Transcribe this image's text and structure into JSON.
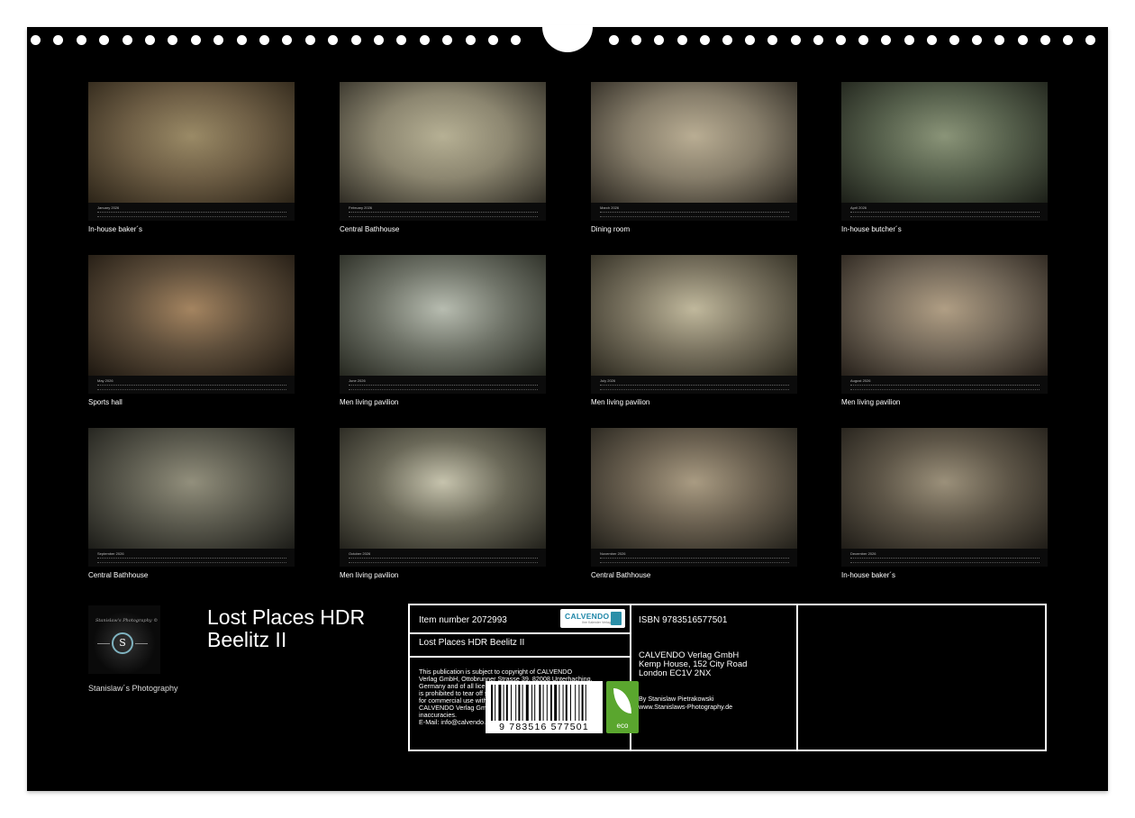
{
  "months": [
    {
      "month": "January 2026",
      "caption": "In-house baker´s",
      "colors": [
        "#6e5e45",
        "#2c2418",
        "#9a8a66"
      ]
    },
    {
      "month": "February 2026",
      "caption": "Central Bathhouse",
      "colors": [
        "#8c8670",
        "#2f2c24",
        "#b6b094"
      ]
    },
    {
      "month": "March 2026",
      "caption": "Dining room",
      "colors": [
        "#867d6a",
        "#2a261f",
        "#b9ad93"
      ]
    },
    {
      "month": "April 2026",
      "caption": "In-house butcher´s",
      "colors": [
        "#56604c",
        "#1c1f18",
        "#8a9478"
      ]
    },
    {
      "month": "May 2026",
      "caption": "Sports hall",
      "colors": [
        "#5e4e3b",
        "#1d1710",
        "#a48460"
      ]
    },
    {
      "month": "June 2026",
      "caption": "Men living pavilion",
      "colors": [
        "#6f7368",
        "#25271f",
        "#b7bcb0"
      ]
    },
    {
      "month": "July 2026",
      "caption": "Men living pavilion",
      "colors": [
        "#7a7360",
        "#2b281e",
        "#c0b89c"
      ]
    },
    {
      "month": "August 2026",
      "caption": "Men living pavilion",
      "colors": [
        "#74695a",
        "#26201a",
        "#b09e84"
      ]
    },
    {
      "month": "September 2026",
      "caption": "Central Bathhouse",
      "colors": [
        "#5b5a4e",
        "#1c1c18",
        "#928f7c"
      ]
    },
    {
      "month": "October 2026",
      "caption": "Men living pavilion",
      "colors": [
        "#6a6858",
        "#22211b",
        "#c6c3ad"
      ]
    },
    {
      "month": "November 2026",
      "caption": "Central Bathhouse",
      "colors": [
        "#6a6050",
        "#22201a",
        "#a99b82"
      ]
    },
    {
      "month": "December 2026",
      "caption": "In-house baker´s",
      "colors": [
        "#5d5547",
        "#1f1c17",
        "#9b907a"
      ]
    }
  ],
  "brand": {
    "logo_text": "Stanislaw's Photography ©",
    "logo_letter": "S",
    "credit": "Stanislaw´s Photography"
  },
  "title": {
    "line1": "Lost Places HDR",
    "line2": "Beelitz II"
  },
  "info": {
    "item_number": "Item number 2072993",
    "calvendo_logo": "CALVENDO",
    "calvendo_sub": "Ihre Kalender Verlag",
    "product_title": "Lost Places HDR Beelitz II",
    "legal": [
      "This publication is subject to copyright of CALVENDO",
      "Verlag GmbH, Ottobrunner Strasse 39, 82008 Unterhaching,",
      "Germany and of all licensed material of its licensers. It",
      "is prohibited to tear off single sheets of this calendar",
      "for commercial use without explicit permission.",
      "CALVENDO Verlag GmbH cannot be held responsible for any",
      "inaccuracies.",
      "E-Mail: info@calvendo.com • www.calvendo.com"
    ],
    "isbn": "ISBN 9783516577501",
    "publisher": [
      "CALVENDO Verlag GmbH",
      "Kemp House, 152 City Road",
      "London EC1V 2NX"
    ],
    "author": [
      "By Stanislaw Pietrakowski",
      "www.Stanislaws-Photography.de"
    ],
    "barcode_digits": "9 783516 577501",
    "eco_label": "eco"
  }
}
